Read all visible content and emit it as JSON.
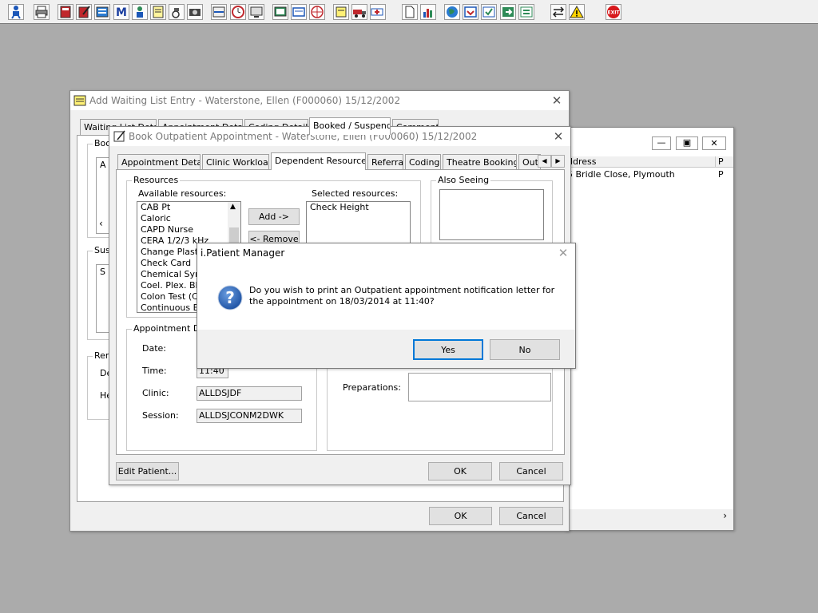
{
  "toolbar": {
    "icons": [
      "patient-icon",
      "print-icon",
      "book-icon",
      "edit-book-icon",
      "register-icon",
      "m-icon",
      "person-icon",
      "notes-icon",
      "wheelchair-icon",
      "camera-icon",
      "scan-icon",
      "clock-icon",
      "monitor-icon",
      "screen-icon",
      "card-icon",
      "globe-icon",
      "note-icon",
      "truck-icon",
      "ambulance-icon",
      "document-icon",
      "chart-icon",
      "world-icon",
      "inbox-icon",
      "check-icon",
      "export-icon",
      "transfer-icon",
      "warning-icon",
      "exit-icon"
    ],
    "exit_label": "EXIT"
  },
  "waiting_list": {
    "title": "Add Waiting List Entry - Waterstone, Ellen (F000060) 15/12/2002",
    "tabs": [
      "Waiting List Details",
      "Appointment Details",
      "Coding Details",
      "Booked / Suspend",
      "Comments"
    ],
    "frag_boo": "Boo",
    "frag_sus": "Sus",
    "frag_ren": "Ren",
    "frag_de": "De",
    "frag_he": "He",
    "frag_a": "A",
    "frag_s": "S",
    "ok": "OK",
    "cancel": "Cancel"
  },
  "bg_window": {
    "col_address": "ddress",
    "col_p": "P",
    "row_address": "5 Bridle Close, Plymouth",
    "row_p": "P"
  },
  "book_outpatient": {
    "title": "Book Outpatient Appointment - Waterstone, Ellen (F000060) 15/12/2002",
    "tabs": [
      "Appointment Details",
      "Clinic Workload",
      "Dependent Resources",
      "Referral",
      "Coding",
      "Theatre Bookings",
      "Out"
    ],
    "resources_label": "Resources",
    "available_label": "Available resources:",
    "available": [
      "CAB Pt",
      "Caloric",
      "CAPD Nurse",
      "CERA 1/2/3 kHz",
      "Change Plaster",
      "Check Card",
      "Chemical Symp",
      "Coel. Plex. Block",
      "Colon Test (CE",
      "Continuous EEG"
    ],
    "selected_label": "Selected resources:",
    "selected": [
      "Check Height"
    ],
    "add_button": "Add ->",
    "remove_button": "<- Remove",
    "also_seeing_label": "Also Seeing",
    "appt_details_label": "Appointment Details",
    "date_label": "Date:",
    "time_label": "Time:",
    "time_value": "11:40",
    "clinic_label": "Clinic:",
    "clinic_value": "ALLDSJDF",
    "session_label": "Session:",
    "session_value": "ALLDSJCONM2DWK",
    "preparations_label": "Preparations:",
    "edit_patient": "Edit Patient...",
    "ok": "OK",
    "cancel": "Cancel"
  },
  "dialog": {
    "title": "i.Patient Manager",
    "message_line1": "Do you wish to print an Outpatient appointment notification letter for",
    "message_line2": "the appointment on 18/03/2014 at 11:40?",
    "yes": "Yes",
    "no": "No"
  },
  "colors": {
    "desktop": "#ababab",
    "accent": "#0078d7",
    "question": "#1b4fa0"
  }
}
